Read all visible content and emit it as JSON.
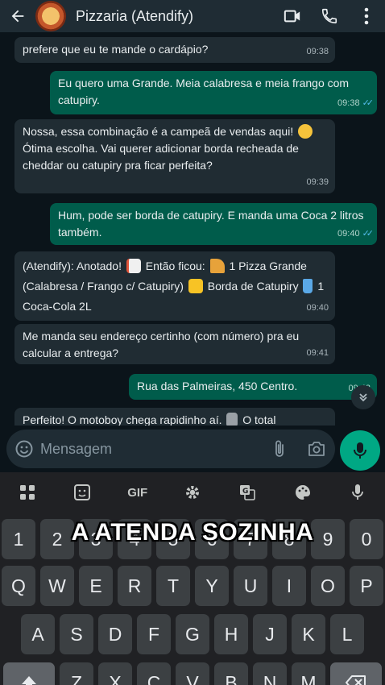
{
  "header": {
    "title": "Pizzaria (Atendify)",
    "back_icon": "arrow-left-icon",
    "video_icon": "video-camera-icon",
    "call_icon": "phone-icon",
    "menu_icon": "more-vert-icon"
  },
  "messages": [
    {
      "dir": "in",
      "text": "prefere que eu te mande o cardápio?",
      "time": "09:38"
    },
    {
      "dir": "out",
      "text": "Eu quero uma Grande. Meia calabresa e meia frango com catupiry.",
      "time": "09:38"
    },
    {
      "dir": "in",
      "text_a": "Nossa, essa combinação é a campeã de vendas aqui!",
      "text_b": "Ótima escolha. Vai querer adicionar borda recheada de cheddar ou catupiry pra ficar perfeita?",
      "time": "09:39"
    },
    {
      "dir": "out",
      "text": "Hum, pode ser borda de catupiry. E manda uma Coca 2 litros também.",
      "time": "09:40"
    },
    {
      "dir": "in",
      "text_a": "(Atendify): Anotado!",
      "text_b": "Então ficou:",
      "text_c": "1 Pizza Grande (Calabresa / Frango c/ Catupiry)",
      "text_d": "Borda de Catupiry",
      "text_e": "1 Coca-Cola 2L",
      "time": "09:40"
    },
    {
      "dir": "in",
      "text": "Me manda seu endereço certinho (com número) pra eu calcular a entrega?",
      "time": "09:41"
    },
    {
      "dir": "out",
      "text": "Rua das Palmeiras, 450 Centro.",
      "time": "09:43"
    },
    {
      "dir": "in",
      "text_a": "Perfeito! O motoboy chega rapidinho aí.",
      "text_b": "O total",
      "time": ""
    }
  ],
  "input": {
    "placeholder": "Mensagem"
  },
  "keyboard": {
    "toolbar": [
      "GIF"
    ],
    "row_numbers": [
      "1",
      "2",
      "3",
      "4",
      "5",
      "6",
      "7",
      "8",
      "9",
      "0"
    ],
    "row_top": [
      "Q",
      "W",
      "E",
      "R",
      "T",
      "Y",
      "U",
      "I",
      "O",
      "P"
    ],
    "row_mid": [
      "A",
      "S",
      "D",
      "F",
      "G",
      "H",
      "J",
      "K",
      "L"
    ],
    "row_bottom": [
      "Z",
      "X",
      "C",
      "V",
      "B",
      "N",
      "M"
    ]
  },
  "overlay_caption": "A ATENDA SOZINHA",
  "colors": {
    "accent": "#00a884",
    "outgoing": "#005c4b",
    "incoming": "#202c33",
    "ticks": "#53bdeb"
  }
}
